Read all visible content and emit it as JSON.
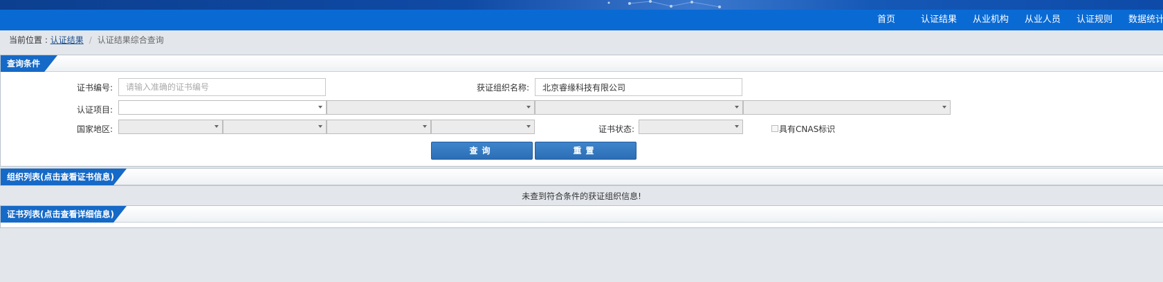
{
  "nav": {
    "items": [
      {
        "label": "首页"
      },
      {
        "label": "认证结果"
      },
      {
        "label": "从业机构"
      },
      {
        "label": "从业人员"
      },
      {
        "label": "认证规则"
      },
      {
        "label": "数据统计"
      }
    ]
  },
  "breadcrumb": {
    "prefix": "当前位置 : ",
    "link": "认证结果",
    "separator": "/",
    "current": "认证结果综合查询"
  },
  "query_panel": {
    "title": "查询条件",
    "cert_no_label": "证书编号:",
    "cert_no_placeholder": "请输入准确的证书编号",
    "cert_no_value": "",
    "org_name_label": "获证组织名称:",
    "org_name_value": "北京睿缘科技有限公司",
    "cert_project_label": "认证项目:",
    "region_label": "国家地区:",
    "cert_status_label": "证书状态:",
    "cnas_label": "具有CNAS标识",
    "query_button": "查询",
    "reset_button": "重置"
  },
  "org_panel": {
    "title": "组织列表(点击查看证书信息)",
    "empty_message": "未查到符合条件的获证组织信息!"
  },
  "cert_panel": {
    "title": "证书列表(点击查看详细信息)"
  },
  "colors": {
    "nav_bg": "#0a6ad4",
    "title_tab": "#1569c7",
    "button": "#3275bd",
    "page_bg": "#e3e7ec"
  }
}
